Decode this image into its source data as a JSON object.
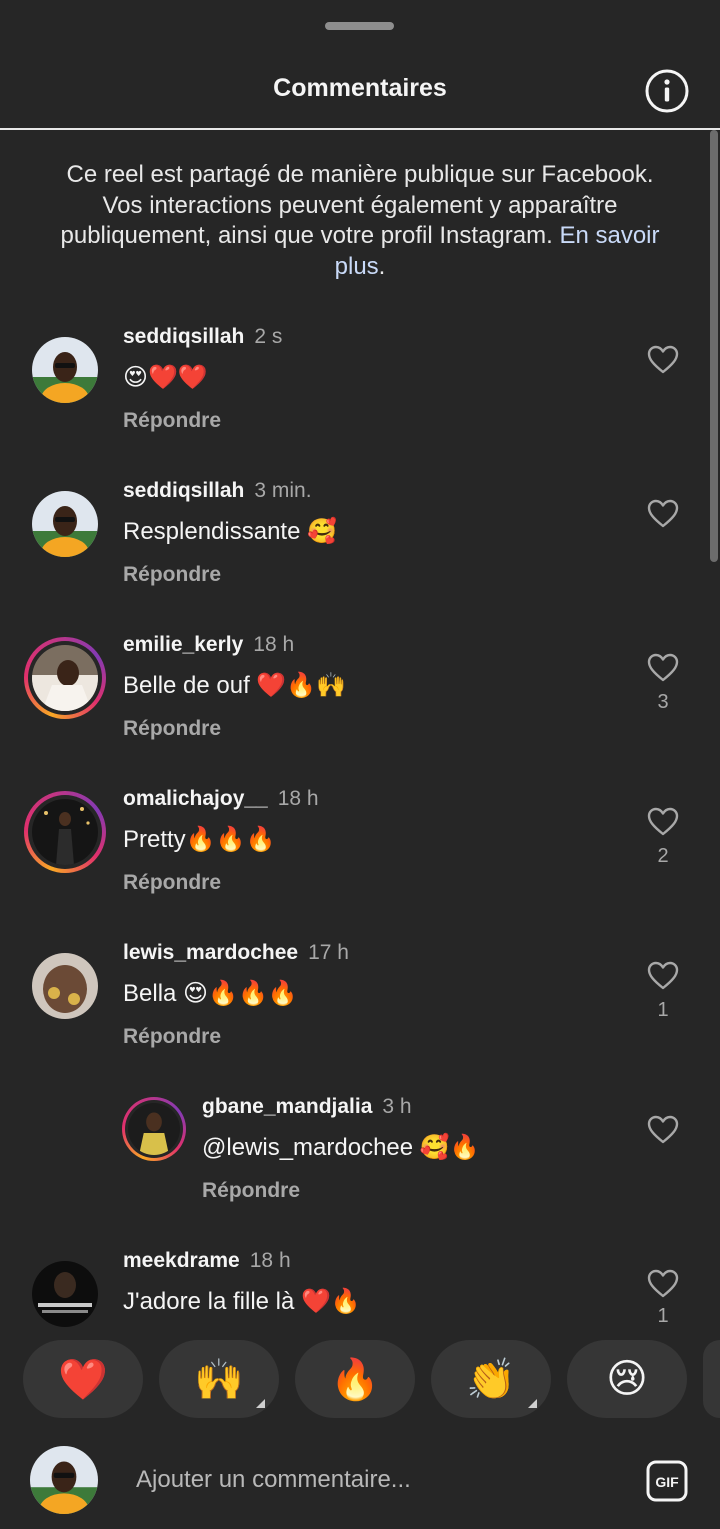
{
  "header": {
    "title": "Commentaires"
  },
  "notice": {
    "text": "Ce reel est partagé de manière publique sur Facebook. Vos interactions peuvent également y apparaître publiquement, ainsi que votre profil Instagram.",
    "link": "En savoir plus",
    "link_suffix": "."
  },
  "comments": [
    {
      "username": "seddiqsillah",
      "time": "2 s",
      "text": "😍❤️❤️",
      "reply": "Répondre",
      "likes": ""
    },
    {
      "username": "seddiqsillah",
      "time": "3 min.",
      "text": "Resplendissante 🥰",
      "reply": "Répondre",
      "likes": ""
    },
    {
      "username": "emilie_kerly",
      "time": "18 h",
      "text": "Belle de ouf ❤️🔥🙌",
      "reply": "Répondre",
      "likes": "3"
    },
    {
      "username": "omalichajoy__",
      "time": "18 h",
      "text": "Pretty🔥🔥🔥",
      "reply": "Répondre",
      "likes": "2"
    },
    {
      "username": "lewis_mardochee",
      "time": "17 h",
      "text": "Bella 😍🔥🔥🔥",
      "reply": "Répondre",
      "likes": "1"
    },
    {
      "username": "gbane_mandjalia",
      "time": "3 h",
      "text": "@lewis_mardochee 🥰🔥",
      "reply": "Répondre",
      "likes": ""
    },
    {
      "username": "meekdrame",
      "time": "18 h",
      "text": "J'adore la fille là ❤️🔥",
      "reply": "",
      "likes": "1"
    }
  ],
  "emoji_bar": [
    "❤️",
    "🙌",
    "🔥",
    "👏",
    "😢"
  ],
  "composer": {
    "placeholder": "Ajouter un commentaire...",
    "gif_label": "GIF"
  },
  "colors": {
    "background": "#262626",
    "text": "#f5f5f5",
    "muted": "#a8a8a8",
    "link": "#c9daf8",
    "pill": "#363636"
  }
}
